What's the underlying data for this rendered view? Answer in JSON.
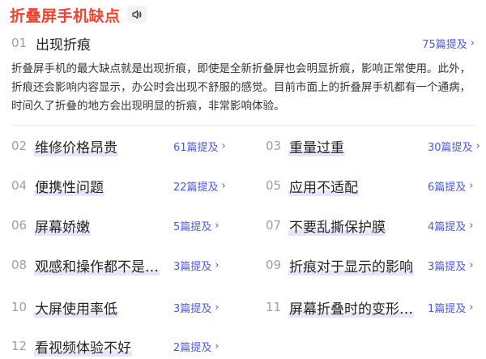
{
  "header": {
    "title": "折叠屏手机缺点",
    "sound_icon": "speaker-icon"
  },
  "featured": {
    "num": "01",
    "title": "出现折痕",
    "mentions": "75篇提及",
    "description": "折叠屏手机的最大缺点就是出现折痕，即使是全新折叠屏也会明显折痕，影响正常使用。此外，折痕还会影响内容显示，办公时会出现不舒服的感觉。目前市面上的折叠屏手机都有一个通病，时间久了折叠的地方会出现明显的折痕，非常影响体验。"
  },
  "items": [
    {
      "num": "02",
      "title": "维修价格昂贵",
      "mentions": "61篇提及"
    },
    {
      "num": "03",
      "title": "重量过重",
      "mentions": "30篇提及"
    },
    {
      "num": "04",
      "title": "便携性问题",
      "mentions": "22篇提及"
    },
    {
      "num": "05",
      "title": "应用不适配",
      "mentions": "6篇提及"
    },
    {
      "num": "06",
      "title": "屏幕娇嫩",
      "mentions": "5篇提及"
    },
    {
      "num": "07",
      "title": "不要乱撕保护膜",
      "mentions": "4篇提及"
    },
    {
      "num": "08",
      "title": "观感和操作都不是…",
      "mentions": "3篇提及"
    },
    {
      "num": "09",
      "title": "折痕对于显示的影响",
      "mentions": "3篇提及"
    },
    {
      "num": "10",
      "title": "大屏使用率低",
      "mentions": "3篇提及"
    },
    {
      "num": "11",
      "title": "屏幕折叠时的变形…",
      "mentions": "1篇提及"
    },
    {
      "num": "12",
      "title": "看视频体验不好",
      "mentions": "2篇提及"
    }
  ],
  "colors": {
    "title": "#f5422f",
    "accent": "#4d5bdb",
    "highlight": "#e7e4fb",
    "number": "#9aa0aa"
  },
  "icons": {
    "chevron": "chevron-right-icon"
  }
}
